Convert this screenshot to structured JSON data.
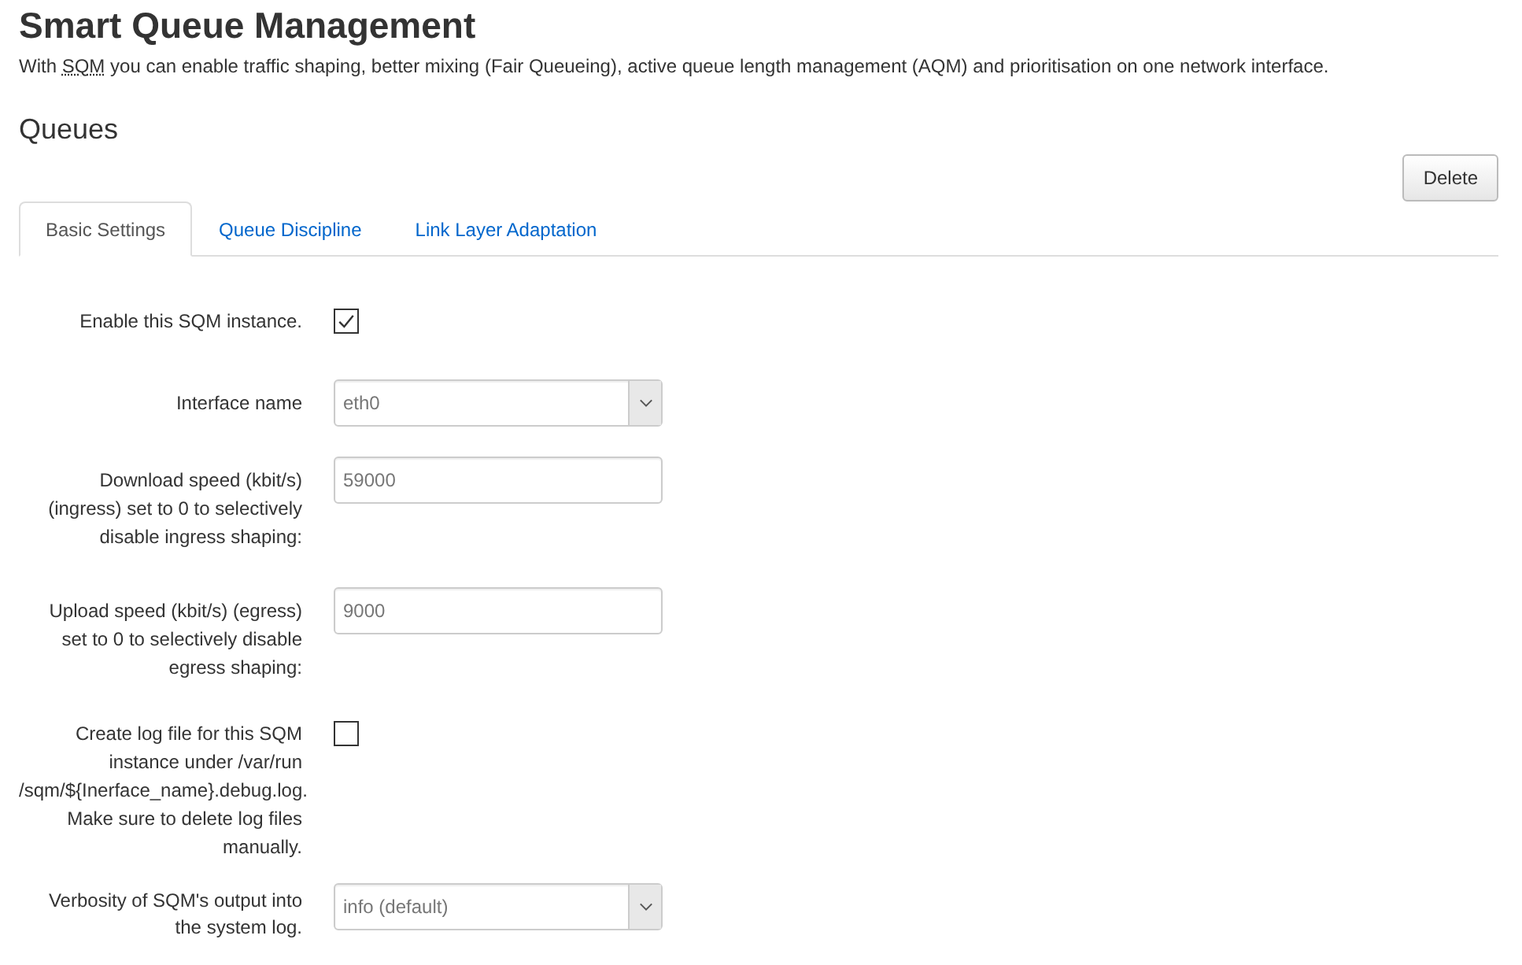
{
  "title": "Smart Queue Management",
  "description": {
    "before": "With ",
    "abbr": "SQM",
    "after": " you can enable traffic shaping, better mixing (Fair Queueing), active queue length management (AQM) and prioritisation on one network interface."
  },
  "section": {
    "title": "Queues",
    "delete_button": "Delete"
  },
  "tabs": [
    {
      "label": "Basic Settings",
      "selected": true
    },
    {
      "label": "Queue Discipline",
      "selected": false
    },
    {
      "label": "Link Layer Adaptation",
      "selected": false
    }
  ],
  "fields": [
    {
      "kind": "checkbox",
      "label": [
        "Enable this SQM instance."
      ],
      "checked": true
    },
    {
      "kind": "select",
      "label": [
        "Interface name"
      ],
      "value": "eth0"
    },
    {
      "kind": "text",
      "label": [
        "Download speed (kbit/s)",
        "(ingress) set to 0 to selectively",
        "disable ingress shaping:"
      ],
      "value": "59000"
    },
    {
      "kind": "text",
      "label": [
        "Upload speed (kbit/s) (egress)",
        "set to 0 to selectively disable",
        "egress shaping:"
      ],
      "value": "9000"
    },
    {
      "kind": "checkbox",
      "label": [
        "Create log file for this SQM",
        "instance under /var/run",
        "/sqm/${Inerface_name}.debug.log.",
        "Make sure to delete log files",
        "manually."
      ],
      "checked": false
    },
    {
      "kind": "select",
      "label": [
        "Verbosity of SQM's output into",
        "the system log."
      ],
      "value": "info (default)"
    }
  ]
}
